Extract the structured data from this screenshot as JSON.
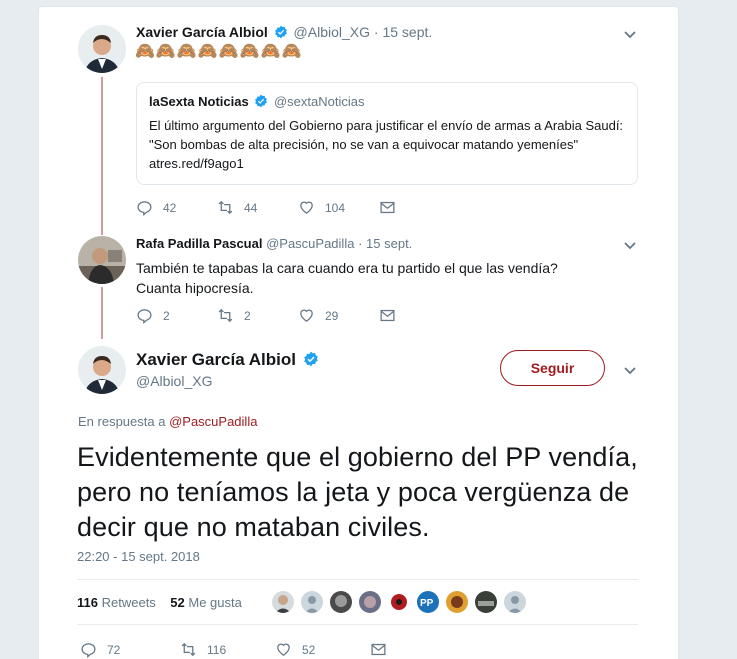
{
  "tweet1": {
    "name": "Xavier García Albiol",
    "handle": "@Albiol_XG",
    "dot": "·",
    "date": "15 sept.",
    "emojis": "🙈🙈🙈🙈🙈🙈🙈🙈",
    "quote": {
      "name": "laSexta Noticias",
      "handle": "@sextaNoticias",
      "text": "El último argumento del Gobierno para justificar el envío de armas a Arabia Saudí: \"Son bombas de alta precisión, no se van a equivocar matando yemeníes\" atres.red/f9ago1"
    },
    "replies": "42",
    "retweets": "44",
    "likes": "104"
  },
  "tweet2": {
    "name": "Rafa Padilla Pascual",
    "handle": "@PascuPadilla",
    "dot": "·",
    "date": "15 sept.",
    "text": "También te tapabas la cara cuando era tu partido el que las vendía? Cuanta hipocresía.",
    "replies": "2",
    "retweets": "2",
    "likes": "29"
  },
  "main": {
    "name": "Xavier García Albiol",
    "handle": "@Albiol_XG",
    "follow_label": "Seguir",
    "in_reply_prefix": "En respuesta a",
    "in_reply_handle": "@PascuPadilla",
    "text": "Evidentemente que el gobierno del PP vendía, pero no teníamos la jeta y poca vergüenza de decir que no mataban civiles.",
    "timestamp": "22:20 - 15 sept. 2018",
    "retweet_count": "116",
    "retweet_label": "Retweets",
    "like_count": "52",
    "like_label": "Me gusta",
    "replies": "72",
    "retweets": "116",
    "likes": "52"
  },
  "colors": {
    "accent": "#9e1b1f",
    "verified": "#1da1f2",
    "thread_line": "#d49aa0",
    "muted": "#657786"
  }
}
